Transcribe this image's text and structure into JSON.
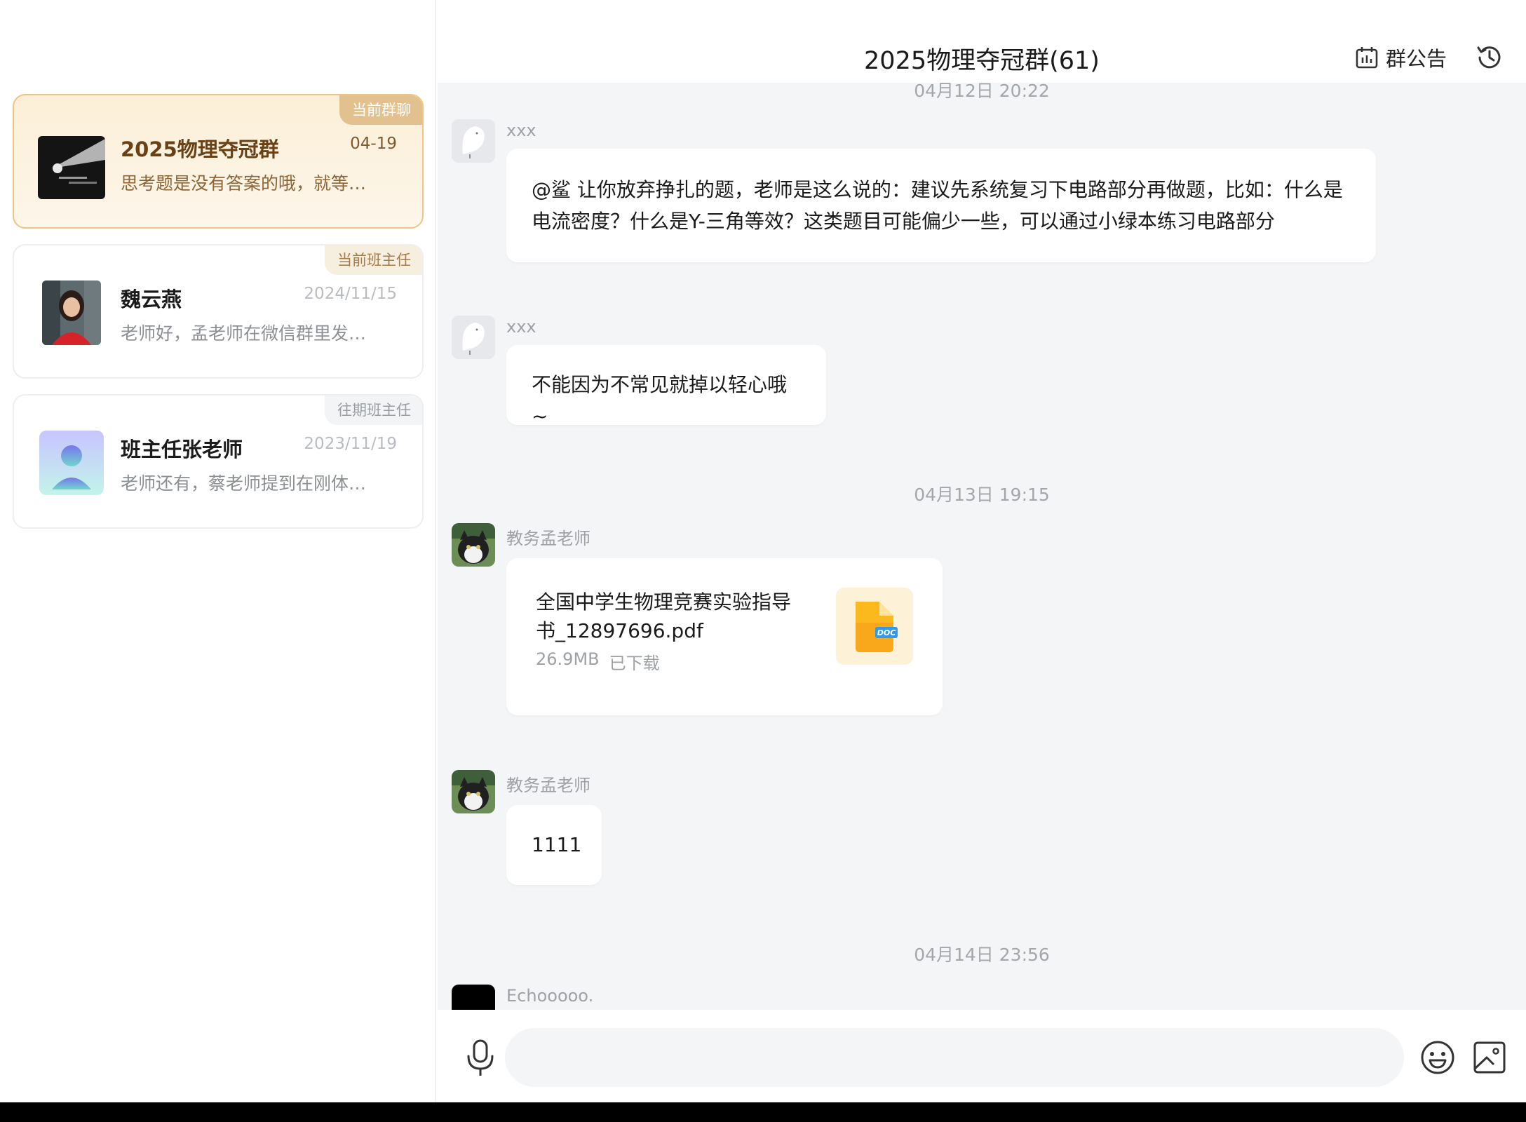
{
  "conversations": [
    {
      "name": "2025物理夺冠群",
      "date": "04-19",
      "preview": "思考题是没有答案的哦，就等…",
      "tag": "当前群聊",
      "active": true
    },
    {
      "name": "魏云燕",
      "date": "2024/11/15",
      "preview": "老师好，孟老师在微信群里发…",
      "tag": "当前班主任",
      "active": false
    },
    {
      "name": "班主任张老师",
      "date": "2023/11/19",
      "preview": "老师还有，蔡老师提到在刚体…",
      "tag": "往期班主任",
      "active": false
    }
  ],
  "chat": {
    "title": "2025物理夺冠群(61)",
    "notice_label": "群公告",
    "timestamps": [
      "04月12日 20:22",
      "04月13日 19:15",
      "04月14日 23:56"
    ],
    "messages": [
      {
        "sender": "xxx",
        "text_line1": "@鲨 让你放弃挣扎的题，老师是这么说的：建议先系统复习下电路部分再做题，比如：什么是",
        "text_line2": "电流密度？什么是Y-三角等效？这类题目可能偏少一些，可以通过小绿本练习电路部分"
      },
      {
        "sender": "xxx",
        "text": "不能因为不常见就掉以轻心哦~"
      },
      {
        "sender": "教务孟老师",
        "file_name_line1": "全国中学生物理竞赛实验指导",
        "file_name_line2": "书_12897696.pdf",
        "file_size": "26.9MB",
        "file_status": "已下载",
        "file_badge": "DOC"
      },
      {
        "sender": "教务孟老师",
        "text": "1111"
      },
      {
        "sender": "Echooooo."
      }
    ]
  },
  "input": {
    "placeholder": ""
  }
}
